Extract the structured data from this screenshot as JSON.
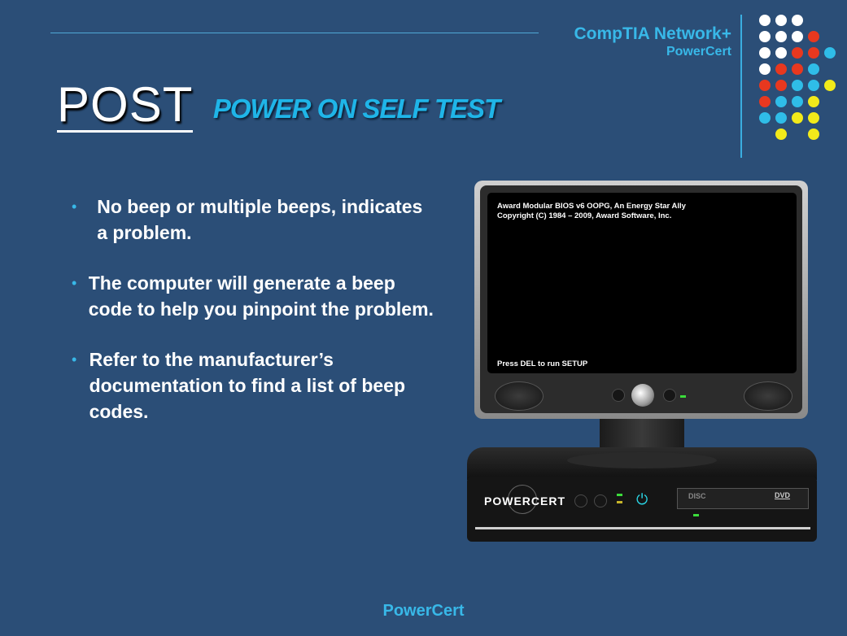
{
  "header": {
    "brand_line1": "CompTIA Network+",
    "brand_line2": "PowerCert"
  },
  "title": {
    "main": "POST",
    "subtitle": "POWER ON SELF TEST"
  },
  "bullets": [
    {
      "marker": "•",
      "text": "No beep or multiple beeps, indicates a problem."
    },
    {
      "marker": "•",
      "text": "The computer will generate a beep code to help you pinpoint the problem."
    },
    {
      "marker": "•",
      "text": "Refer to the manufacturer’s documentation to find a list of beep codes."
    }
  ],
  "monitor": {
    "bios_line1": "Award Modular BIOS  v6 OOPG, An Energy Star Ally",
    "bios_line2": "Copyright (C) 1984 – 2009, Award Software, Inc.",
    "bios_prompt": "Press DEL to run SETUP"
  },
  "computer": {
    "logo": "POWERCERT",
    "drive_label": "DISC",
    "dvd_label": "DVD"
  },
  "footer": "PowerCert",
  "colors": {
    "background": "#2b4e77",
    "accent": "#38b8e8",
    "dot_white": "#ffffff",
    "dot_red": "#e8381f",
    "dot_blue": "#2fbde8",
    "dot_yellow": "#f2ea1a"
  }
}
